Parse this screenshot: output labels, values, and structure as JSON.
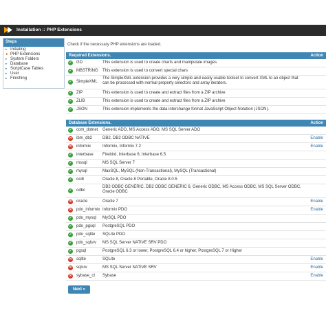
{
  "header": {
    "title": "Installation :: PHP Extensions"
  },
  "sidebar": {
    "heading": "Steps",
    "items": [
      {
        "label": "Initiating",
        "active": false
      },
      {
        "label": "PHP Extensions",
        "active": true
      },
      {
        "label": "System Folders",
        "active": false
      },
      {
        "label": "Database",
        "active": false
      },
      {
        "label": "ScriptCase Tables",
        "active": false
      },
      {
        "label": "User",
        "active": false
      },
      {
        "label": "Finishing",
        "active": false
      }
    ]
  },
  "intro": "Check if the necessary PHP extensions are loaded.",
  "required": {
    "heading": "Required Extensions.",
    "action_label": "Action",
    "rows": [
      {
        "name": "GD",
        "desc": "This extension is used to create charts and manipulate images",
        "status": "ok",
        "action": ""
      },
      {
        "name": "MBSTRING",
        "desc": "This extension is used to convert special chars",
        "status": "ok",
        "action": ""
      },
      {
        "name": "SimpleXML",
        "desc": "The SimpleXML extension provides a very simple and easily usable toolset to convert XML to an object that can be processed with normal property selectors and array iterators.",
        "status": "ok",
        "action": ""
      },
      {
        "name": "ZIP",
        "desc": "This extension is used to create and extract files from a ZIP archive",
        "status": "ok",
        "action": ""
      },
      {
        "name": "ZLIB",
        "desc": "This extension is used to create and extract files from a ZIP archive",
        "status": "ok",
        "action": ""
      },
      {
        "name": "JSON",
        "desc": "This extension implements the data interchange format JavaScript Object Notation (JSON).",
        "status": "ok",
        "action": ""
      }
    ]
  },
  "database": {
    "heading": "Database Extensions.",
    "action_label": "Action",
    "rows": [
      {
        "name": "com_dotnet",
        "desc": "Generic ADO, MS Access ADO, MS SQL Server ADO",
        "status": "ok",
        "action": ""
      },
      {
        "name": "ibm_db2",
        "desc": "DB2, DB2 ODBC NATIVE",
        "status": "err",
        "action": "Enable"
      },
      {
        "name": "informix",
        "desc": "Informix, Informix 7.2",
        "status": "err",
        "action": "Enable"
      },
      {
        "name": "interbase",
        "desc": "Firebird, Interbase 6, Interbase 6.5",
        "status": "ok",
        "action": ""
      },
      {
        "name": "mssql",
        "desc": "MS SQL Server 7",
        "status": "ok",
        "action": ""
      },
      {
        "name": "mysql",
        "desc": "MaxSQL, MySQL (Non-Transactional), MySQL (Transactional)",
        "status": "ok",
        "action": ""
      },
      {
        "name": "oci8",
        "desc": "Oracle 8, Oracle 8 Portable, Oracle 8.0.5",
        "status": "ok",
        "action": ""
      },
      {
        "name": "odbc",
        "desc": "DB2 ODBC GENERIC, DB2 ODBC GENERIC 6, Generic ODBC, MS Access ODBC, MS SQL Server ODBC, Oracle ODBC",
        "status": "ok",
        "action": ""
      },
      {
        "name": "oracle",
        "desc": "Oracle 7",
        "status": "err",
        "action": "Enable"
      },
      {
        "name": "pdo_informix",
        "desc": "Informix PDO",
        "status": "err",
        "action": "Enable"
      },
      {
        "name": "pdo_mysql",
        "desc": "MySQL PDO",
        "status": "ok",
        "action": ""
      },
      {
        "name": "pdo_pgsql",
        "desc": "PostgreSQL PDO",
        "status": "ok",
        "action": ""
      },
      {
        "name": "pdo_sqlite",
        "desc": "SQLite PDO",
        "status": "ok",
        "action": ""
      },
      {
        "name": "pdo_sqlsrv",
        "desc": "MS SQL Server NATIVE SRV PDO",
        "status": "ok",
        "action": ""
      },
      {
        "name": "pgsql",
        "desc": "PostgreSQL 6.3 or lower, PostgreSQL 6.4 or higher, PostgreSQL 7 or Higher",
        "status": "ok",
        "action": ""
      },
      {
        "name": "sqlite",
        "desc": "SQLite",
        "status": "err",
        "action": "Enable"
      },
      {
        "name": "sqlsrv",
        "desc": "MS SQL Server NATIVE SRV",
        "status": "err",
        "action": "Enable"
      },
      {
        "name": "sybase_ct",
        "desc": "Sybase",
        "status": "err",
        "action": "Enable"
      }
    ]
  },
  "next_label": "Next »",
  "colors": {
    "accent": "#3f86b4",
    "ok": "#3aa03a",
    "error": "#d23c2c",
    "topbar": "#2b2b2b"
  }
}
